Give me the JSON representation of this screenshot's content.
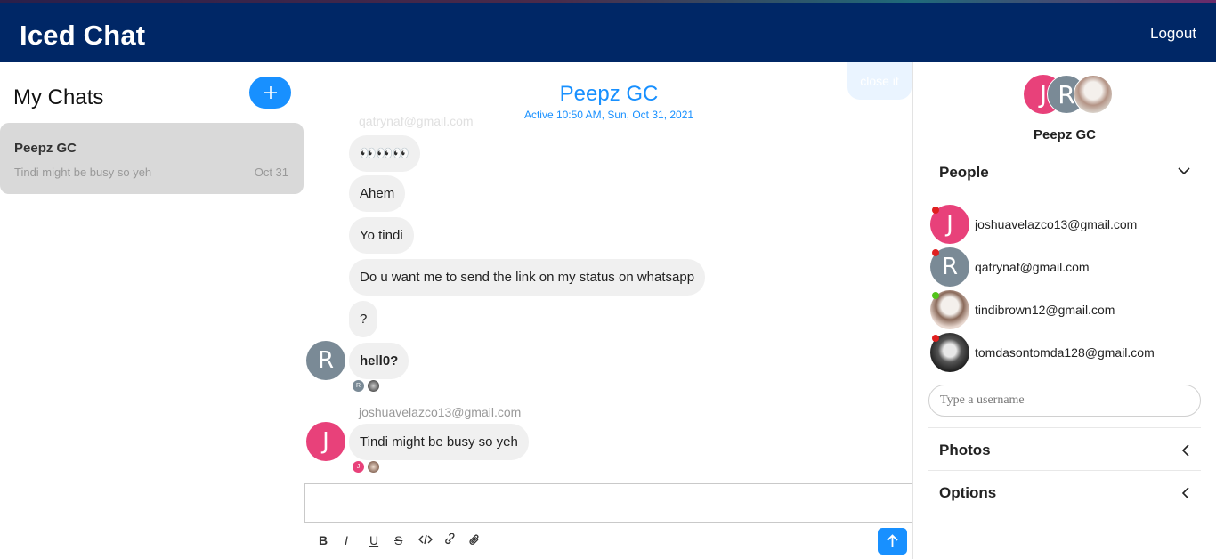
{
  "app": {
    "title": "Iced Chat",
    "logout_label": "Logout",
    "colors": {
      "header": "#002766",
      "accent": "#1890ff",
      "avatar_j": "#e8417a",
      "avatar_r": "#7a8a96"
    }
  },
  "chat_list": {
    "title": "My Chats",
    "new_chat_icon": "plus-icon",
    "chats": [
      {
        "name": "Peepz GC",
        "last_message": "Tindi might be busy so yeh",
        "date": "Oct 31"
      }
    ]
  },
  "feed": {
    "title": "Peepz GC",
    "subtitle": "Active 10:50 AM, Sun, Oct 31, 2021",
    "close_label": "close it",
    "messages": [
      {
        "sender": "qatrynaf@gmail.com",
        "text": "👀👀👀"
      },
      {
        "text": "Ahem"
      },
      {
        "text": "Yo tindi"
      },
      {
        "text": "Do u want me to send the link on my status on whatsapp"
      },
      {
        "text": "?"
      },
      {
        "text": "hell0?",
        "avatar": "R"
      },
      {
        "sender": "joshuavelazco13@gmail.com",
        "text": "Tindi might be busy so yeh",
        "avatar": "J"
      }
    ],
    "read_receipts_1": [
      "R",
      "photo"
    ],
    "read_receipts_2": [
      "J",
      "photo"
    ],
    "toolbar": [
      "B",
      "I",
      "U",
      "S",
      "code",
      "link",
      "attach"
    ],
    "send_icon": "arrow-up-icon"
  },
  "settings": {
    "group_avatars": [
      "J",
      "R",
      "photo"
    ],
    "group_name": "Peepz GC",
    "people_label": "People",
    "people": [
      {
        "avatar": "J",
        "email": "joshuavelazco13@gmail.com",
        "status": "offline"
      },
      {
        "avatar": "R",
        "email": "qatrynaf@gmail.com",
        "status": "offline"
      },
      {
        "avatar": "photo",
        "email": "tindibrown12@gmail.com",
        "status": "online"
      },
      {
        "avatar": "photo",
        "email": "tomdasontomda128@gmail.com",
        "status": "offline"
      }
    ],
    "username_placeholder": "Type a username",
    "photos_label": "Photos",
    "options_label": "Options"
  }
}
